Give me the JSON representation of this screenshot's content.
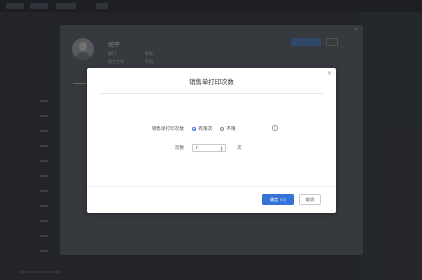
{
  "detail_panel": {
    "name": "胡平",
    "fields": [
      "部门",
      "职务",
      "员工工号",
      "手机"
    ]
  },
  "dialog": {
    "title": "销售单打印次数",
    "close_symbol": "×",
    "limit_label": "销售单打印次数",
    "options": [
      {
        "label": "有限次",
        "selected": true
      },
      {
        "label": "不限",
        "selected": false
      }
    ],
    "info_symbol": "i",
    "count_label": "次数",
    "count_value": "7",
    "count_unit": "次",
    "confirm_label": "确定",
    "confirm_shortcut": "(F2)",
    "cancel_label": "取消"
  },
  "colors": {
    "primary": "#3574d6",
    "overlay": "#2a2d33"
  }
}
